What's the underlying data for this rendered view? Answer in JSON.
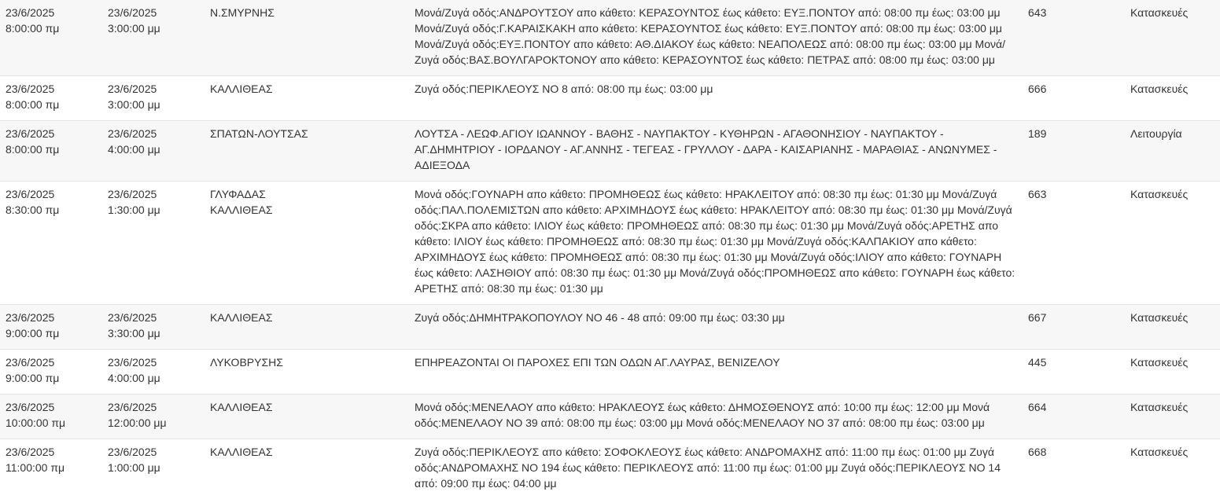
{
  "rows": [
    {
      "start_date": "23/6/2025",
      "start_time": "8:00:00 πμ",
      "end_date": "23/6/2025",
      "end_time": "3:00:00 μμ",
      "area": [
        "Ν.ΣΜΥΡΝΗΣ"
      ],
      "description": "Μονά/Ζυγά οδός:ΑΝΔΡΟΥΤΣΟΥ απο κάθετο: ΚΕΡΑΣΟΥΝΤΟΣ έως κάθετο: ΕΥΞ.ΠΟΝΤΟΥ από: 08:00 πμ έως: 03:00 μμ Μονά/Ζυγά οδός:Γ.ΚΑΡΑΙΣΚΑΚΗ απο κάθετο: ΚΕΡΑΣΟΥΝΤΟΣ έως κάθετο: ΕΥΞ.ΠΟΝΤΟΥ από: 08:00 πμ έως: 03:00 μμ Μονά/Ζυγά οδός:ΕΥΞ.ΠΟΝΤΟΥ απο κάθετο: ΑΘ.ΔΙΑΚΟΥ έως κάθετο: ΝΕΑΠΟΛΕΩΣ από: 08:00 πμ έως: 03:00 μμ Μονά/Ζυγά οδός:ΒΑΣ.ΒΟΥΛΓΑΡΟΚΤΟΝΟΥ απο κάθετο: ΚΕΡΑΣΟΥΝΤΟΣ έως κάθετο: ΠΕΤΡΑΣ από: 08:00 πμ έως: 03:00 μμ",
      "number": "643",
      "type": "Κατασκευές"
    },
    {
      "start_date": "23/6/2025",
      "start_time": "8:00:00 πμ",
      "end_date": "23/6/2025",
      "end_time": "3:00:00 μμ",
      "area": [
        "ΚΑΛΛΙΘΕΑΣ"
      ],
      "description": "Ζυγά οδός:ΠΕΡΙΚΛΕΟΥΣ ΝΟ 8 από: 08:00 πμ έως: 03:00 μμ",
      "number": "666",
      "type": "Κατασκευές"
    },
    {
      "start_date": "23/6/2025",
      "start_time": "8:00:00 πμ",
      "end_date": "23/6/2025",
      "end_time": "4:00:00 μμ",
      "area": [
        "ΣΠΑΤΩΝ-ΛΟΥΤΣΑΣ"
      ],
      "description": "ΛΟΥΤΣΑ - ΛΕΩΦ.ΑΓΙΟΥ ΙΩΑΝΝΟΥ - ΒΑΘΗΣ - ΝΑΥΠΑΚΤΟΥ - ΚΥΘΗΡΩΝ - ΑΓΑΘΟΝΗΣΙΟΥ - ΝΑΥΠΑΚΤΟΥ - ΑΓ.ΔΗΜΗΤΡΙΟΥ - ΙΟΡΔΑΝΟΥ - ΑΓ.ΑΝΝΗΣ - ΤΕΓΕΑΣ - ΓΡΥΛΛΟΥ - ΔΑΡΑ - ΚΑΙΣΑΡΙΑΝΗΣ - ΜΑΡΑΘΙΑΣ - ΑΝΩΝΥΜΕΣ - ΑΔΙΕΞΟΔΑ",
      "number": "189",
      "type": "Λειτουργία"
    },
    {
      "start_date": "23/6/2025",
      "start_time": "8:30:00 πμ",
      "end_date": "23/6/2025",
      "end_time": "1:30:00 μμ",
      "area": [
        "ΓΛΥΦΑΔΑΣ",
        "ΚΑΛΛΙΘΕΑΣ"
      ],
      "description": "Μονά οδός:ΓΟΥΝΑΡΗ απο κάθετο: ΠΡΟΜΗΘΕΩΣ έως κάθετο: ΗΡΑΚΛΕΙΤΟΥ από: 08:30 πμ έως: 01:30 μμ Μονά/Ζυγά οδός:ΠΑΛ.ΠΟΛΕΜΙΣΤΩΝ απο κάθετο: ΑΡΧΙΜΗΔΟΥΣ έως κάθετο: ΗΡΑΚΛΕΙΤΟΥ από: 08:30 πμ έως: 01:30 μμ Μονά/Ζυγά οδός:ΣΚΡΑ απο κάθετο: ΙΛΙΟΥ έως κάθετο: ΠΡΟΜΗΘΕΩΣ από: 08:30 πμ έως: 01:30 μμ Μονά/Ζυγά οδός:ΑΡΕΤΗΣ απο κάθετο: ΙΛΙΟΥ έως κάθετο: ΠΡΟΜΗΘΕΩΣ από: 08:30 πμ έως: 01:30 μμ Μονά/Ζυγά οδός:ΚΑΛΠΑΚΙΟΥ απο κάθετο: ΑΡΧΙΜΗΔΟΥΣ έως κάθετο: ΠΡΟΜΗΘΕΩΣ από: 08:30 πμ έως: 01:30 μμ Μονά/Ζυγά οδός:ΙΛΙΟΥ απο κάθετο: ΓΟΥΝΑΡΗ έως κάθετο: ΛΑΣΗΘΙΟΥ από: 08:30 πμ έως: 01:30 μμ Μονά/Ζυγά οδός:ΠΡΟΜΗΘΕΩΣ απο κάθετο: ΓΟΥΝΑΡΗ έως κάθετο: ΑΡΕΤΗΣ από: 08:30 πμ έως: 01:30 μμ",
      "number": "663",
      "type": "Κατασκευές"
    },
    {
      "start_date": "23/6/2025",
      "start_time": "9:00:00 πμ",
      "end_date": "23/6/2025",
      "end_time": "3:30:00 μμ",
      "area": [
        "ΚΑΛΛΙΘΕΑΣ"
      ],
      "description": "Ζυγά οδός:ΔΗΜΗΤΡΑΚΟΠΟΥΛΟΥ ΝΟ 46 - 48 από: 09:00 πμ έως: 03:30 μμ",
      "number": "667",
      "type": "Κατασκευές"
    },
    {
      "start_date": "23/6/2025",
      "start_time": "9:00:00 πμ",
      "end_date": "23/6/2025",
      "end_time": "4:00:00 μμ",
      "area": [
        "ΛΥΚΟΒΡΥΣΗΣ"
      ],
      "description": "ΕΠΗΡΕΑΖΟΝΤΑΙ ΟΙ ΠΑΡΟΧΕΣ ΕΠΙ ΤΩΝ ΟΔΩΝ ΑΓ.ΛΑΥΡΑΣ, ΒΕΝΙΖΕΛΟΥ",
      "number": "445",
      "type": "Κατασκευές"
    },
    {
      "start_date": "23/6/2025",
      "start_time": "10:00:00 πμ",
      "end_date": "23/6/2025",
      "end_time": "12:00:00 μμ",
      "area": [
        "ΚΑΛΛΙΘΕΑΣ"
      ],
      "description": "Μονά οδός:ΜΕΝΕΛΑΟΥ απο κάθετο: ΗΡΑΚΛΕΟΥΣ έως κάθετο: ΔΗΜΟΣΘΕΝΟΥΣ από: 10:00 πμ έως: 12:00 μμ Μονά οδός:ΜΕΝΕΛΑΟΥ ΝΟ 39 από: 08:00 πμ έως: 03:00 μμ Μονά οδός:ΜΕΝΕΛΑΟΥ ΝΟ 37 από: 08:00 πμ έως: 03:00 μμ",
      "number": "664",
      "type": "Κατασκευές"
    },
    {
      "start_date": "23/6/2025",
      "start_time": "11:00:00 πμ",
      "end_date": "23/6/2025",
      "end_time": "1:00:00 μμ",
      "area": [
        "ΚΑΛΛΙΘΕΑΣ"
      ],
      "description": "Ζυγά οδός:ΠΕΡΙΚΛΕΟΥΣ απο κάθετο: ΣΟΦΟΚΛΕΟΥΣ έως κάθετο: ΑΝΔΡΟΜΑΧΗΣ από: 11:00 πμ έως: 01:00 μμ Ζυγά οδός:ΑΝΔΡΟΜΑΧΗΣ ΝΟ 194 έως κάθετο: ΠΕΡΙΚΛΕΟΥΣ από: 11:00 πμ έως: 01:00 μμ Ζυγά οδός:ΠΕΡΙΚΛΕΟΥΣ ΝΟ 14 από: 09:00 πμ έως: 04:00 μμ",
      "number": "668",
      "type": "Κατασκευές"
    }
  ]
}
